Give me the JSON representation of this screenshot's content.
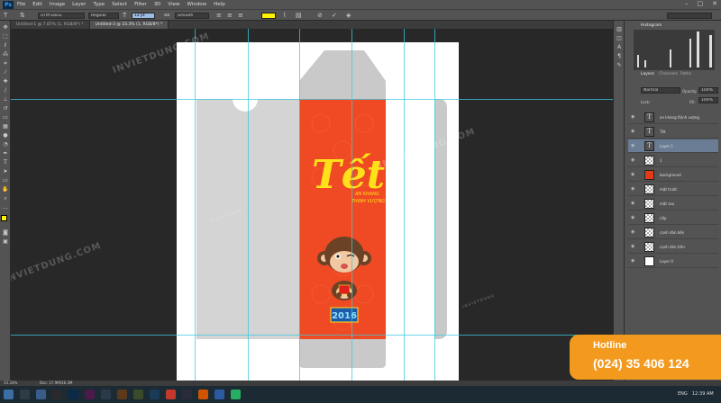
{
  "menu": {
    "logo": "Ps",
    "items": [
      "File",
      "Edit",
      "Image",
      "Layer",
      "Type",
      "Select",
      "Filter",
      "3D",
      "View",
      "Window",
      "Help"
    ]
  },
  "options": {
    "font_family": "UTM Ebisu",
    "font_style": "Regular",
    "font_size": "12 pt",
    "antialias": "Smooth",
    "text_color": "#fff200"
  },
  "tabs": [
    {
      "label": "Untitled-1 @ 7.87% (1, RGB/8*) *",
      "active": false
    },
    {
      "label": "Untitled-3 @ 33.3% (1, RGB/8*) *",
      "active": true
    }
  ],
  "design": {
    "tet_glyph": "Tết",
    "subtitle_line1": "AN KHANG",
    "subtitle_line2": "THỊNH VƯỢNG",
    "year": "2016",
    "envelope_color": "#ef4a23",
    "year_box_color": "#1e5aa8",
    "year_text_color": "#8fe4ff"
  },
  "watermark": {
    "text_large": "INVIETDUNG.COM",
    "text_small": "INVIETDUNG"
  },
  "panels": {
    "histogram_title": "Histogram",
    "layers_tabs": [
      "Layers",
      "Channels",
      "Paths"
    ],
    "blend_mode": "Normal",
    "opacity_label": "Opacity:",
    "opacity_value": "100%",
    "lock_label": "Lock:",
    "fill_label": "Fill:",
    "fill_value": "100%",
    "layers": [
      {
        "name": "an khang thịnh vượng",
        "type": "text"
      },
      {
        "name": "Tết",
        "type": "text"
      },
      {
        "name": "Layer 1",
        "type": "text",
        "selected": true
      },
      {
        "name": "1",
        "type": "checker"
      },
      {
        "name": "background",
        "type": "red"
      },
      {
        "name": "mặt trước",
        "type": "checker"
      },
      {
        "name": "mặt sau",
        "type": "checker"
      },
      {
        "name": "nắp",
        "type": "checker"
      },
      {
        "name": "cạnh dán bên",
        "type": "checker"
      },
      {
        "name": "cạnh dán trên",
        "type": "checker"
      },
      {
        "name": "Layer 0",
        "type": "white"
      }
    ]
  },
  "status": {
    "zoom": "33.33%",
    "doc": "Doc: 17.9M/36.3M"
  },
  "taskbar": {
    "lang": "ENG",
    "time": "12:39 AM"
  },
  "hotline": {
    "title": "Hotline",
    "number": "(024) 35 406 124"
  }
}
